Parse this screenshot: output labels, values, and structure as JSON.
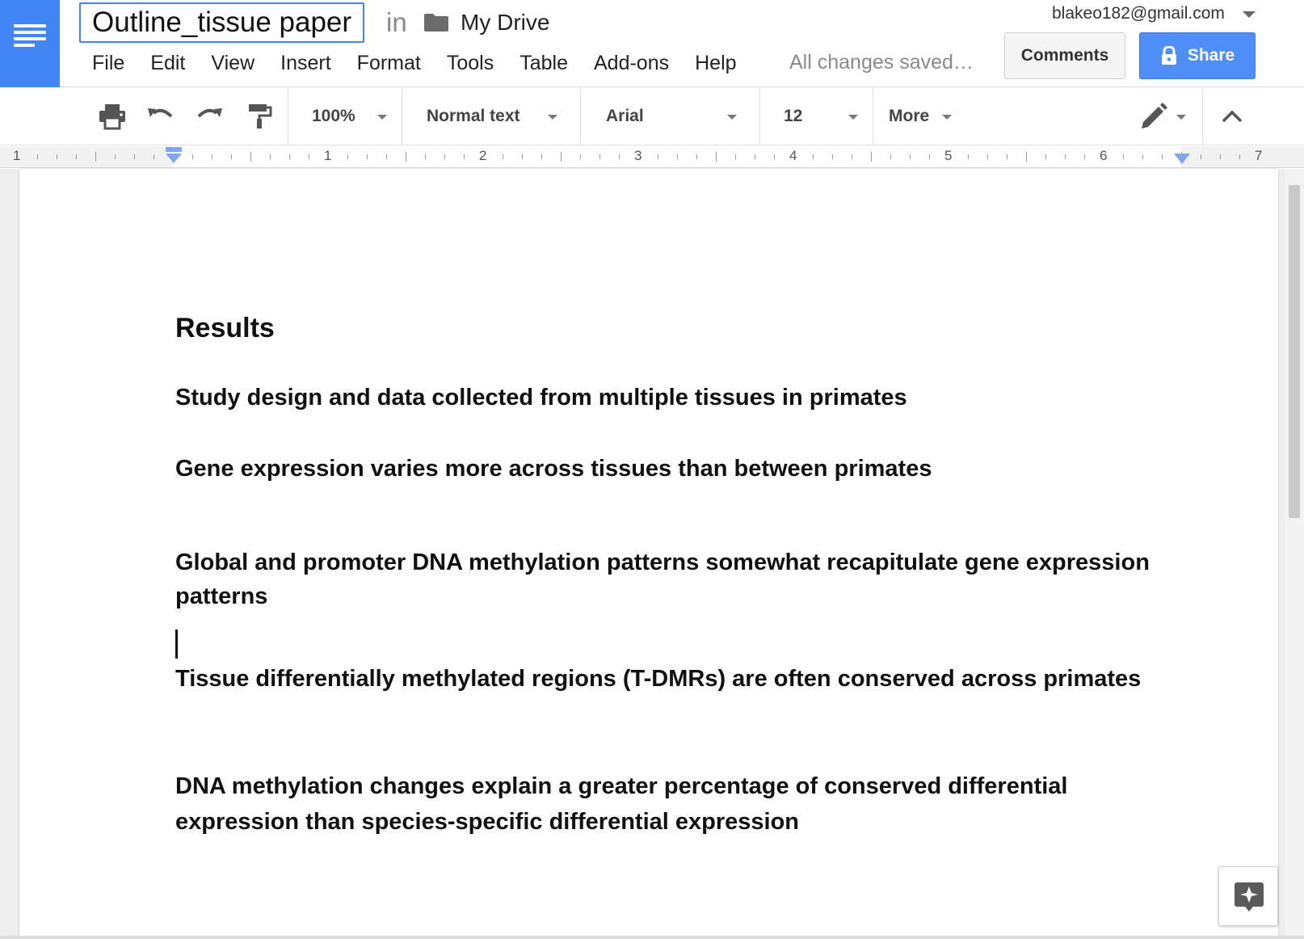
{
  "header": {
    "doc_title": "Outline_tissue paper",
    "in_word": "in",
    "folder_name": "My Drive",
    "save_status": "All changes saved…",
    "account_email": "blakeo182@gmail.com",
    "comments_label": "Comments",
    "share_label": "Share"
  },
  "menu": [
    "File",
    "Edit",
    "View",
    "Insert",
    "Format",
    "Tools",
    "Table",
    "Add-ons",
    "Help"
  ],
  "toolbar": {
    "zoom": "100%",
    "style": "Normal text",
    "font": "Arial",
    "size": "12",
    "more": "More"
  },
  "ruler": {
    "labels": [
      "1",
      "1",
      "2",
      "3",
      "4",
      "5",
      "6",
      "7"
    ]
  },
  "document": {
    "heading": "Results",
    "paragraphs": [
      "Study design and data collected from multiple tissues in primates",
      "Gene expression varies more across tissues than between primates",
      "Global and promoter DNA methylation patterns somewhat recapitulate gene expression patterns",
      "Tissue differentially methylated regions (T-DMRs) are often conserved across primates",
      "DNA methylation changes explain a greater percentage of conserved differential expression than species-specific differential expression"
    ]
  },
  "colors": {
    "brand_blue": "#4285f4",
    "share_blue": "#4d8ef8"
  }
}
